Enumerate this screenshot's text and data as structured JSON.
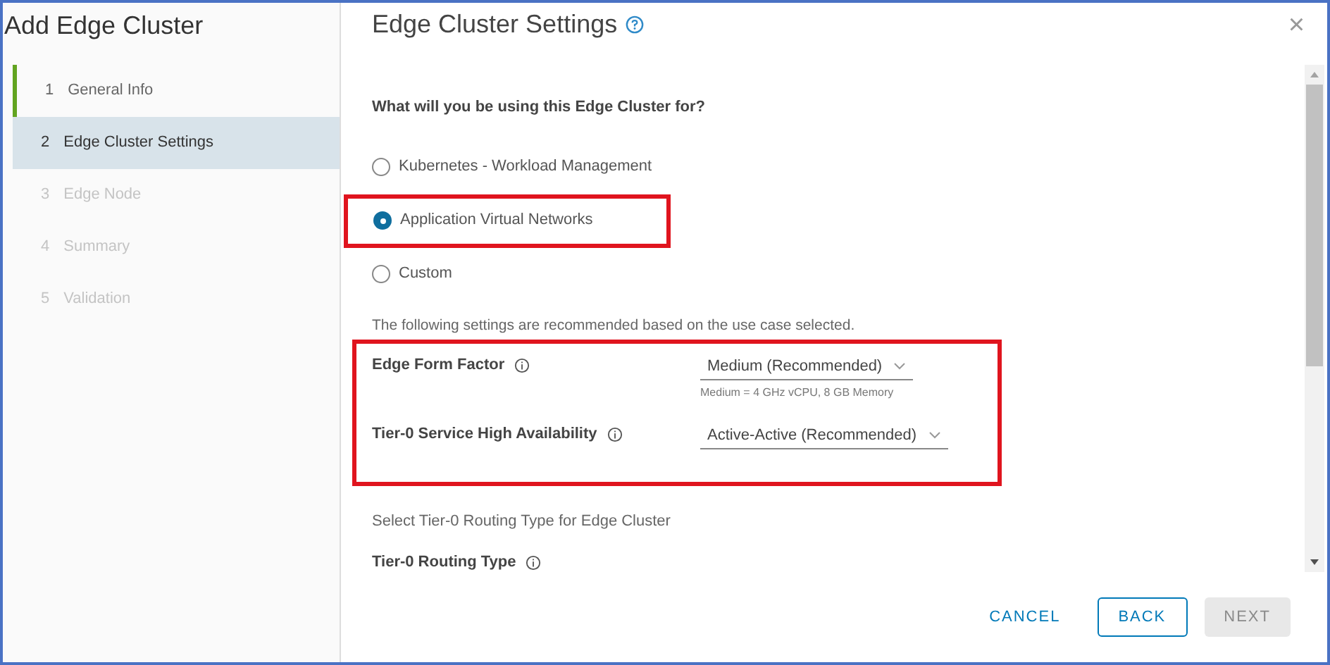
{
  "sidebar": {
    "title": "Add Edge Cluster",
    "steps": [
      {
        "number": "1",
        "label": "General Info",
        "completed": true,
        "selected": false,
        "disabled": false
      },
      {
        "number": "2",
        "label": "Edge Cluster Settings",
        "completed": false,
        "selected": true,
        "disabled": false
      },
      {
        "number": "3",
        "label": "Edge Node",
        "completed": false,
        "selected": false,
        "disabled": true
      },
      {
        "number": "4",
        "label": "Summary",
        "completed": false,
        "selected": false,
        "disabled": true
      },
      {
        "number": "5",
        "label": "Validation",
        "completed": false,
        "selected": false,
        "disabled": true
      }
    ]
  },
  "main": {
    "title": "Edge Cluster Settings",
    "close": "×",
    "question": "What will you be using this Edge Cluster for?",
    "options": [
      {
        "label": "Kubernetes - Workload Management",
        "selected": false,
        "highlighted": false
      },
      {
        "label": "Application Virtual Networks",
        "selected": true,
        "highlighted": true
      },
      {
        "label": "Custom",
        "selected": false,
        "highlighted": false
      }
    ],
    "recommend_note": "The following settings are recommended based on the use case selected.",
    "settings_highlighted": true,
    "settings": [
      {
        "label": "Edge Form Factor",
        "value": "Medium (Recommended)",
        "hint": "Medium = 4 GHz vCPU, 8 GB Memory"
      },
      {
        "label": "Tier-0 Service High Availability",
        "value": "Active-Active (Recommended)"
      }
    ],
    "routing_note": "Select Tier-0 Routing Type for Edge Cluster",
    "routing_label": "Tier-0 Routing Type"
  },
  "buttons": [
    {
      "label": "CANCEL",
      "kind": "flat",
      "disabled": false
    },
    {
      "label": "BACK",
      "kind": "outline",
      "disabled": false
    },
    {
      "label": "NEXT",
      "kind": "solid",
      "disabled": true
    }
  ]
}
